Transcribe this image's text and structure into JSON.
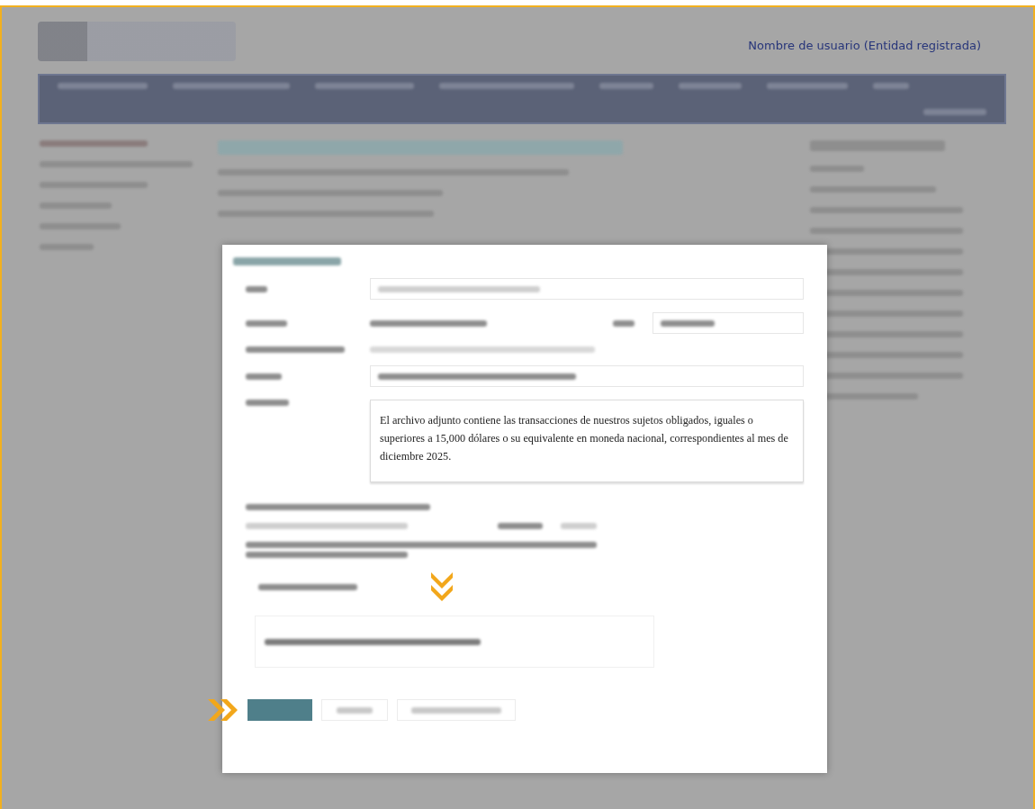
{
  "header": {
    "user_name": "Nombre de usuario (Entidad registrada)"
  },
  "dialog": {
    "message": "El archivo adjunto contiene las transacciones de  nuestros sujetos obligados, iguales o superiores a 15,000 dólares o su equivalente en moneda nacional, correspondientes al mes de diciembre 2025."
  }
}
